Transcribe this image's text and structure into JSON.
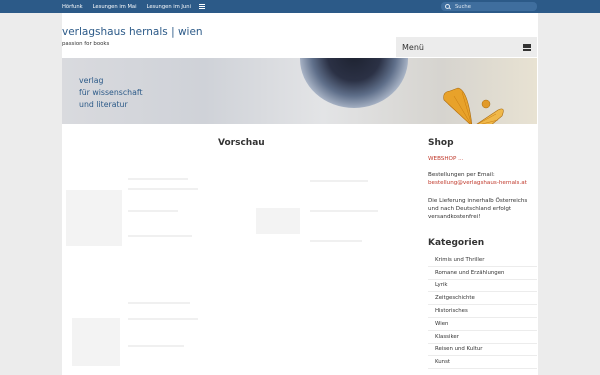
{
  "topnav": {
    "items": [
      {
        "label": "Hörfunk"
      },
      {
        "label": "Lesungen im Mai"
      },
      {
        "label": "Lesungen im Juni"
      }
    ]
  },
  "search": {
    "placeholder": "Suche"
  },
  "header": {
    "title": "verlagshaus hernals | wien",
    "tagline": "passion for books",
    "menu_label": "Menü"
  },
  "banner": {
    "line1": "verlag",
    "line2": "für wissenschaft",
    "line3": "und literatur"
  },
  "main": {
    "heading": "Vorschau"
  },
  "sidebar": {
    "shop_title": "Shop",
    "webshop_link": "WEBSHOP ...",
    "order_label": "Bestellungen per Email:",
    "order_email": "bestellung@verlagshaus-hernals.at",
    "delivery_text": "Die Lieferung innerhalb Österreichs und nach Deutschland erfolgt versandkostenfrei!",
    "categories_title": "Kategorien",
    "categories": [
      {
        "label": "Krimis und Thriller"
      },
      {
        "label": "Romane und Erzählungen"
      },
      {
        "label": "Lyrik"
      },
      {
        "label": "Zeitgeschichte"
      },
      {
        "label": "Historisches"
      },
      {
        "label": "Wien"
      },
      {
        "label": "Klassiker"
      },
      {
        "label": "Reisen und Kultur"
      },
      {
        "label": "Kunst"
      }
    ]
  },
  "colors": {
    "topbar": "#2c5a88",
    "accent_link": "#c0392b",
    "title_blue": "#2c5a88",
    "background": "#ececec"
  }
}
